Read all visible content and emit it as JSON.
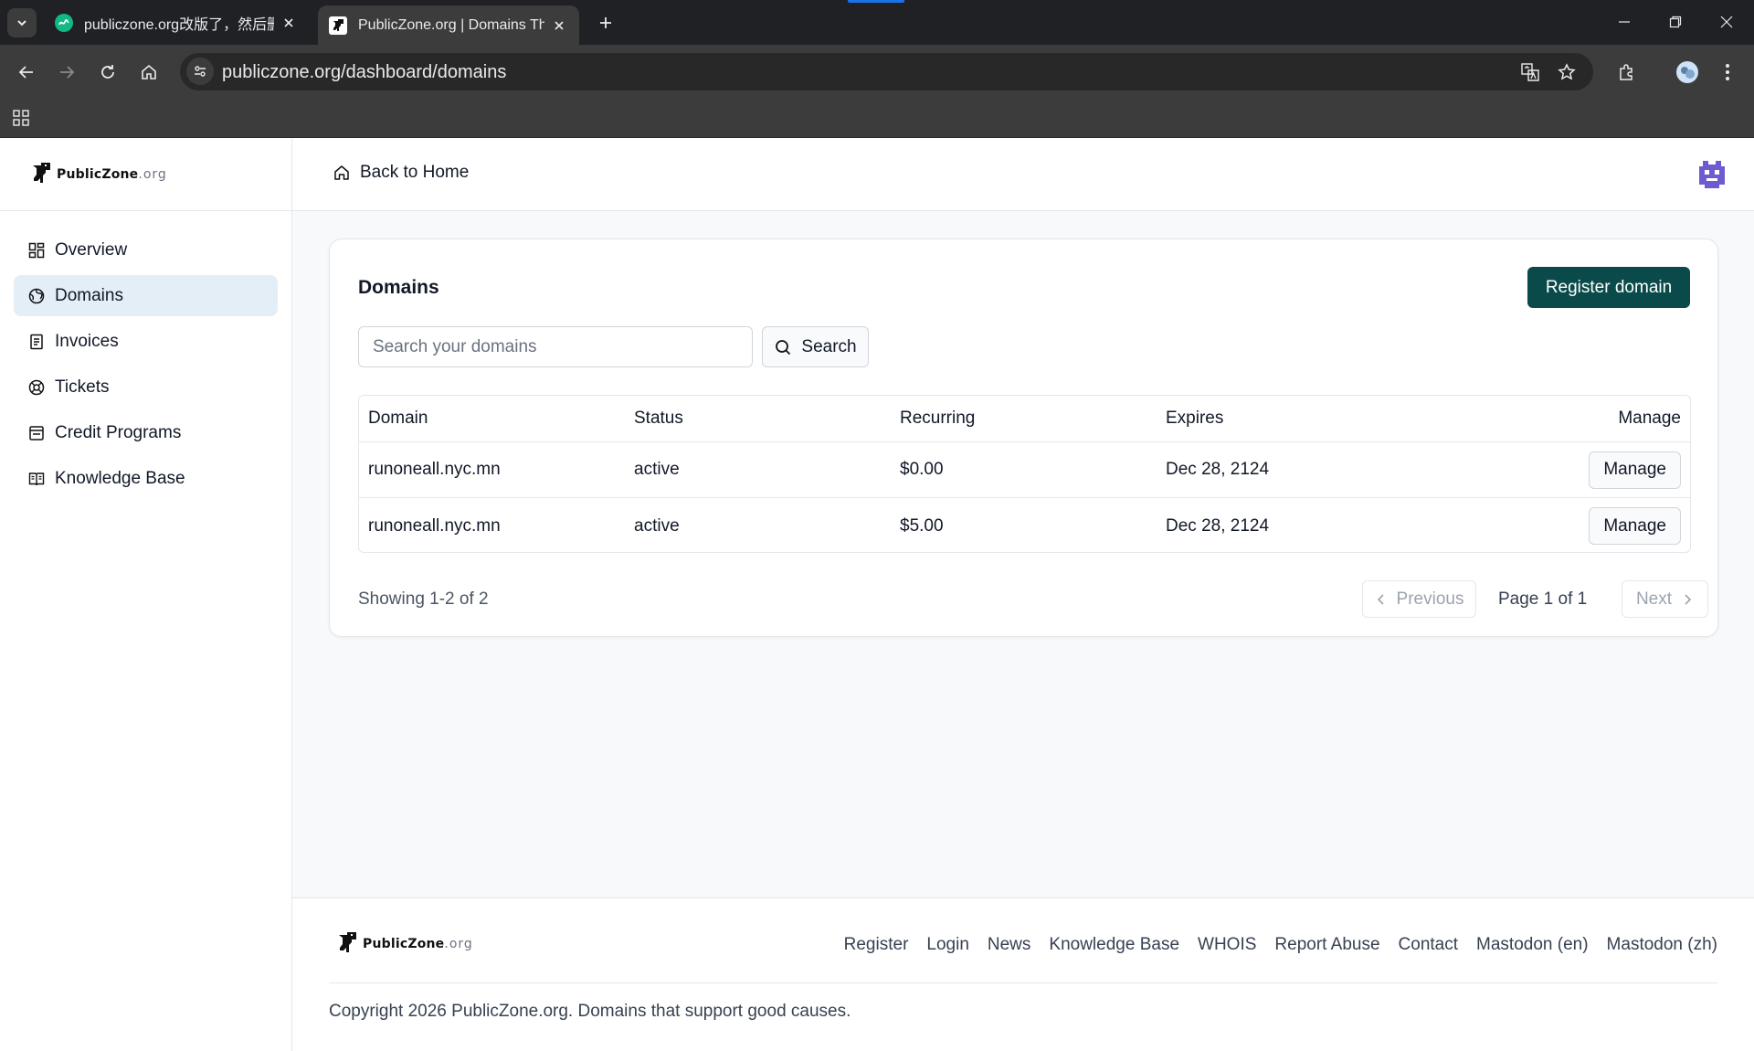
{
  "browser": {
    "tabs": [
      {
        "title": "publiczone.org改版了，然后删",
        "active": false
      },
      {
        "title": "PublicZone.org | Domains Th",
        "active": true
      }
    ],
    "url": "publiczone.org/dashboard/domains"
  },
  "brand": {
    "name": "PublicZone",
    "tld": ".org"
  },
  "sidebar": {
    "items": [
      {
        "label": "Overview",
        "icon": "grid-icon"
      },
      {
        "label": "Domains",
        "icon": "globe-icon",
        "active": true
      },
      {
        "label": "Invoices",
        "icon": "document-icon"
      },
      {
        "label": "Tickets",
        "icon": "lifebuoy-icon"
      },
      {
        "label": "Credit Programs",
        "icon": "wallet-icon"
      },
      {
        "label": "Knowledge Base",
        "icon": "book-icon"
      }
    ]
  },
  "header": {
    "back_label": "Back to Home"
  },
  "domains": {
    "title": "Domains",
    "register_label": "Register domain",
    "search_placeholder": "Search your domains",
    "search_label": "Search",
    "columns": [
      "Domain",
      "Status",
      "Recurring",
      "Expires",
      "Manage"
    ],
    "rows": [
      {
        "domain": "runoneall.nyc.mn",
        "status": "active",
        "recurring": "$0.00",
        "expires": "Dec 28, 2124",
        "action": "Manage"
      },
      {
        "domain": "runoneall.nyc.mn",
        "status": "active",
        "recurring": "$5.00",
        "expires": "Dec 28, 2124",
        "action": "Manage"
      }
    ],
    "showing": "Showing 1-2 of 2",
    "prev_label": "Previous",
    "page_label": "Page 1 of 1",
    "next_label": "Next"
  },
  "footer": {
    "links": [
      "Register",
      "Login",
      "News",
      "Knowledge Base",
      "WHOIS",
      "Report Abuse",
      "Contact",
      "Mastodon (en)",
      "Mastodon (zh)"
    ],
    "copyright": "Copyright 2026 PublicZone.org. Domains that support good causes."
  },
  "colors": {
    "primary": "#0b4a4a",
    "active_nav": "#e3eef6",
    "avatar": "#6d5bd0"
  }
}
